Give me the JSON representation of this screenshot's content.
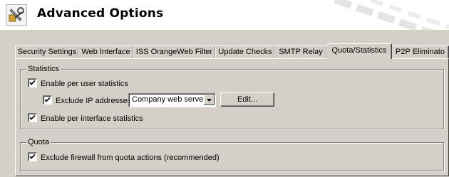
{
  "header": {
    "title": "Advanced Options",
    "icon": "tools-icon"
  },
  "tabs": [
    {
      "label": "Security Settings",
      "active": false
    },
    {
      "label": "Web Interface",
      "active": false
    },
    {
      "label": "ISS OrangeWeb Filter",
      "active": false
    },
    {
      "label": "Update Checks",
      "active": false
    },
    {
      "label": "SMTP Relay",
      "active": false
    },
    {
      "label": "Quota/Statistics",
      "active": true
    },
    {
      "label": "P2P Eliminato",
      "active": false
    }
  ],
  "statistics": {
    "group_label": "Statistics",
    "enable_per_user": {
      "label": "Enable per user statistics",
      "checked": true
    },
    "exclude_ip": {
      "label": "Exclude IP addresses",
      "checked": true
    },
    "ip_group_select": {
      "value": "Company web servers"
    },
    "edit_button": {
      "label": "Edit..."
    },
    "enable_per_interface": {
      "label": "Enable per interface statistics",
      "checked": true
    }
  },
  "quota": {
    "group_label": "Quota",
    "exclude_firewall": {
      "label": "Exclude firewall from quota actions (recommended)",
      "checked": true
    }
  },
  "colors": {
    "panel": "#d4d0c8",
    "header_bg": "#ffffff"
  }
}
